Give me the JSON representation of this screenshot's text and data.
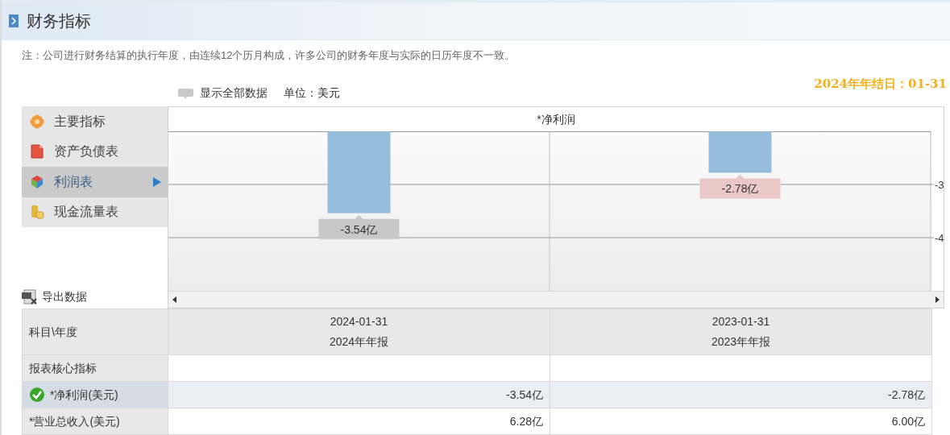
{
  "header": {
    "title": "财务指标"
  },
  "note": "注：公司进行财务结算的执行年度，由连续12个历月构成，许多公司的财务年度与实际的日历年度不一致。",
  "toolbar": {
    "show_all": "显示全部数据",
    "unit": "单位：美元",
    "year_end": "2024年年结日：01-31"
  },
  "sidebar": {
    "items": [
      {
        "label": "主要指标",
        "kind": "flower",
        "selected": false
      },
      {
        "label": "资产负债表",
        "kind": "document",
        "selected": false
      },
      {
        "label": "利润表",
        "kind": "cube",
        "selected": true
      },
      {
        "label": "现金流量表",
        "kind": "coins",
        "selected": false
      }
    ]
  },
  "export": "导出数据",
  "chart": {
    "chart_data": {
      "type": "bar",
      "title": "*净利润",
      "values": [
        -3.54,
        -2.78
      ],
      "ylim": [
        -5,
        -2
      ],
      "yticks": [
        -3,
        -4
      ],
      "value_labels": [
        "-3.54亿",
        "-2.78亿"
      ]
    },
    "bar_labels": [
      {
        "selected": false
      },
      {
        "selected": true
      }
    ]
  },
  "table": {
    "columns": [
      {
        "label": "科目\\年度"
      },
      {
        "date": "2024-01-31",
        "report": "2024年年报"
      },
      {
        "date": "2023-01-31",
        "report": "2023年年报"
      }
    ],
    "rows": [
      {
        "kind": "section",
        "label": "报表核心指标"
      },
      {
        "kind": "data",
        "label": "*净利润(美元)",
        "selected": true,
        "values": [
          "-3.54亿",
          "-2.78亿"
        ]
      },
      {
        "kind": "data",
        "label": "*营业总收入(美元)",
        "selected": false,
        "values": [
          "6.28亿",
          "6.00亿"
        ]
      }
    ]
  }
}
